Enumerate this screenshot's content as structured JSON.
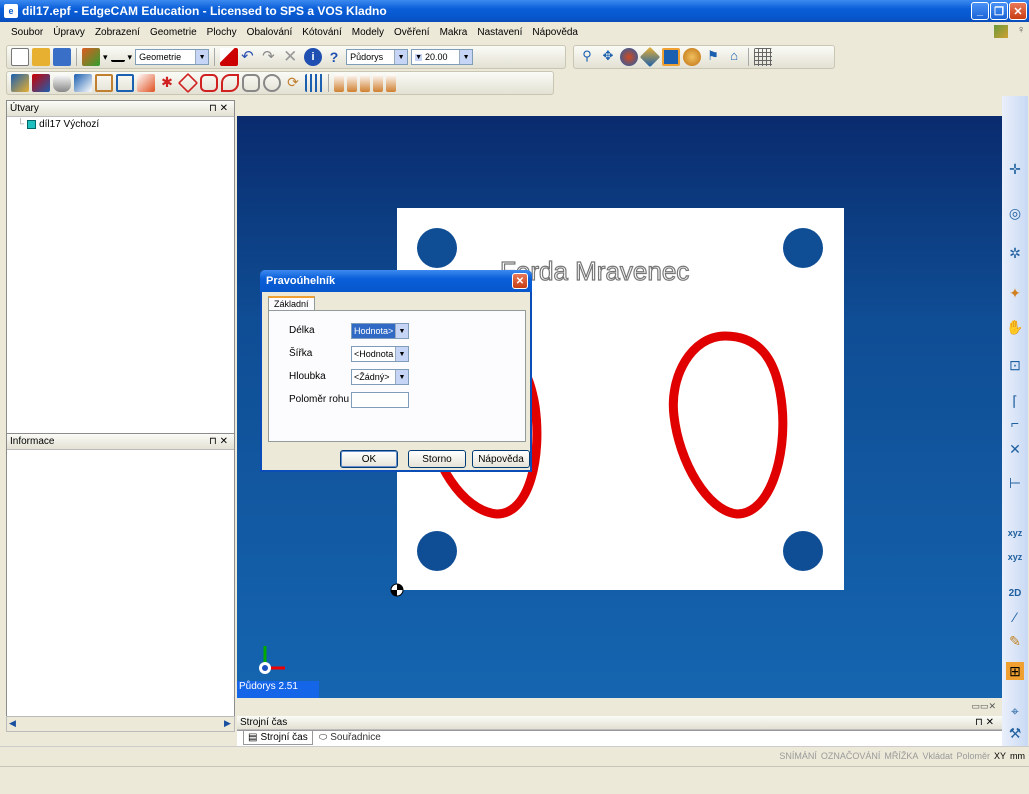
{
  "window": {
    "title": "dil17.epf - EdgeCAM Education - Licensed to SPS a VOS Kladno"
  },
  "menu": [
    "Soubor",
    "Úpravy",
    "Zobrazení",
    "Geometrie",
    "Plochy",
    "Obalování",
    "Kótování",
    "Modely",
    "Ověření",
    "Makra",
    "Nastavení",
    "Nápověda"
  ],
  "toolbar": {
    "layer_combo": "Geometrie",
    "view_combo": "Půdorys",
    "grid_combo": "20.00"
  },
  "panels": {
    "utvary": {
      "title": "Útvary",
      "tree_item": "díl17 Výchozí"
    },
    "informace": {
      "title": "Informace"
    },
    "strojni_cas": {
      "title": "Strojní čas"
    },
    "tabs": [
      "Strojní čas",
      "Souřadnice"
    ]
  },
  "viewport": {
    "part_text": "Ferda Mravenec",
    "view_label": "Půdorys 2.51",
    "colors": {
      "bg_top": "#0a2b6e",
      "bg_bottom": "#1565b0",
      "hole": "#0f4d94",
      "profile": "#e00000"
    }
  },
  "dialog": {
    "title": "Pravoúhelník",
    "tab": "Základní",
    "fields": [
      {
        "label": "Délka",
        "value": "Hodnota>"
      },
      {
        "label": "Šířka",
        "value": "<Hodnota"
      },
      {
        "label": "Hloubka",
        "value": "<Žádný>"
      },
      {
        "label": "Poloměr rohu",
        "value": ""
      }
    ],
    "buttons": {
      "ok": "OK",
      "cancel": "Storno",
      "help": "Nápověda"
    }
  },
  "statusbar": {
    "items": [
      "SNÍMÁNÍ",
      "OZNAČOVÁNÍ",
      "MŘÍŽKA",
      "Vkládat",
      "Poloměr",
      "XY",
      "mm"
    ]
  }
}
